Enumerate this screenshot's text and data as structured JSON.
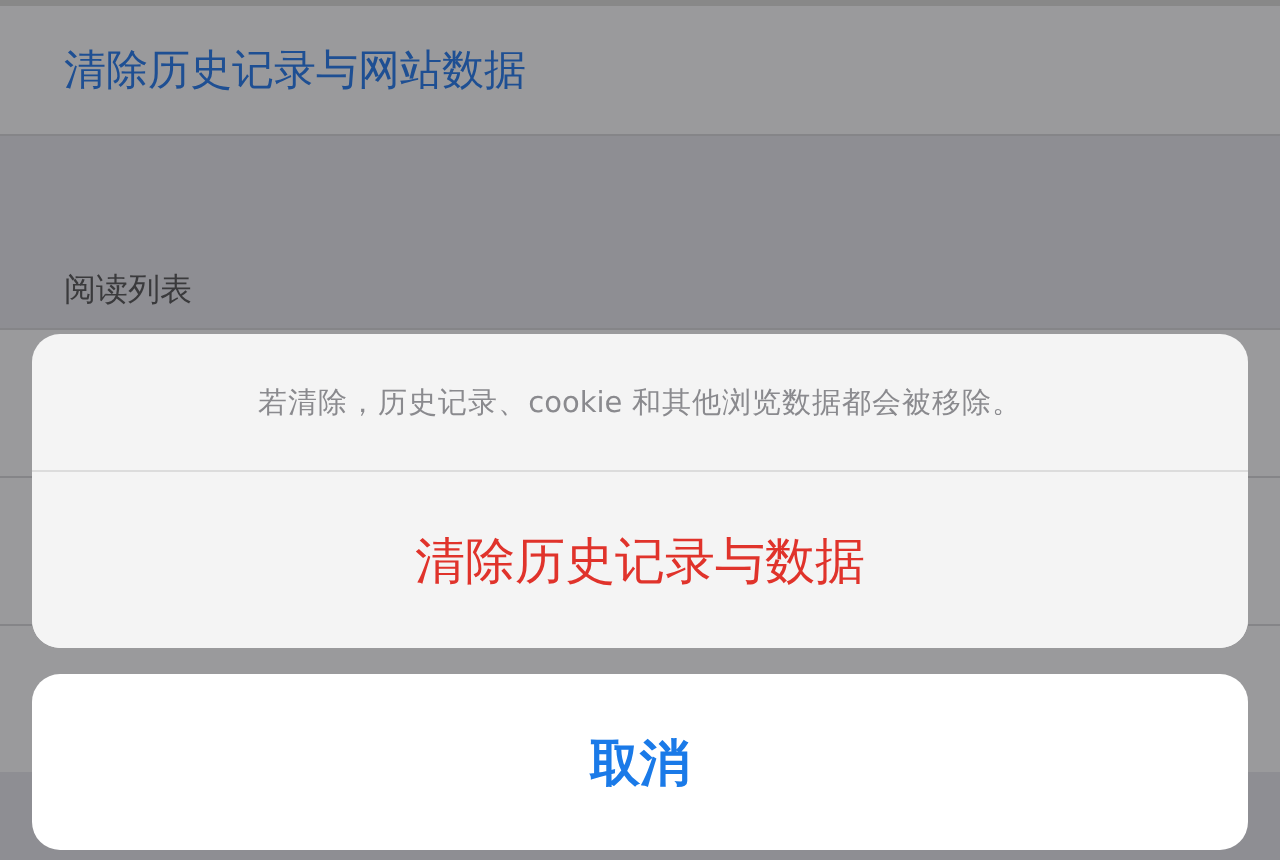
{
  "settings": {
    "clear_link": "清除历史记录与网站数据",
    "section_header": "阅读列表"
  },
  "action_sheet": {
    "message": "若清除，历史记录、cookie 和其他浏览数据都会被移除。",
    "actions": [
      {
        "label": "清除历史记录与数据",
        "kind": "destructive"
      }
    ],
    "cancel": {
      "label": "取消"
    }
  }
}
